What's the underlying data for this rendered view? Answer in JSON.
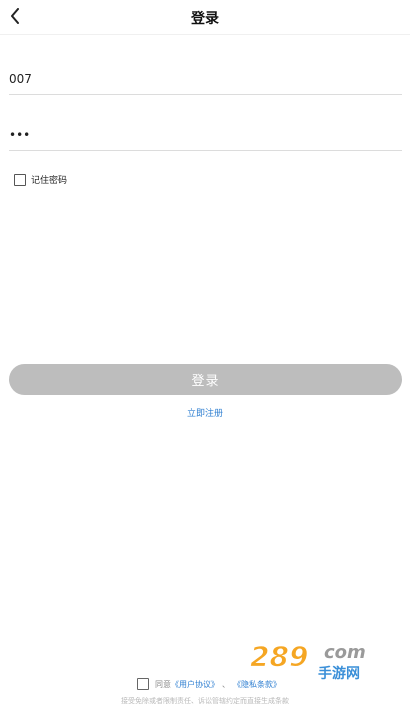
{
  "header": {
    "title": "登录",
    "back_icon": "chevron-left-icon"
  },
  "form": {
    "username_value": "007",
    "password_value": "•••",
    "remember_label": "记住密码"
  },
  "actions": {
    "login_label": "登录",
    "register_label": "立即注册"
  },
  "agreement": {
    "prefix": "同意",
    "user_agreement": "《用户协议》",
    "separator": "、",
    "privacy_policy": "《隐私条款》",
    "disclaimer": "接受免除或者限制责任、诉讼管辖约定而直接生成条款"
  },
  "watermark": {
    "number": "289",
    "suffix": "com",
    "sub": "手游网"
  },
  "colors": {
    "link": "#2f7fd1",
    "button_disabled": "#bdbdbd",
    "watermark_orange": "#f5a623",
    "watermark_blue": "#3a8fd8"
  }
}
